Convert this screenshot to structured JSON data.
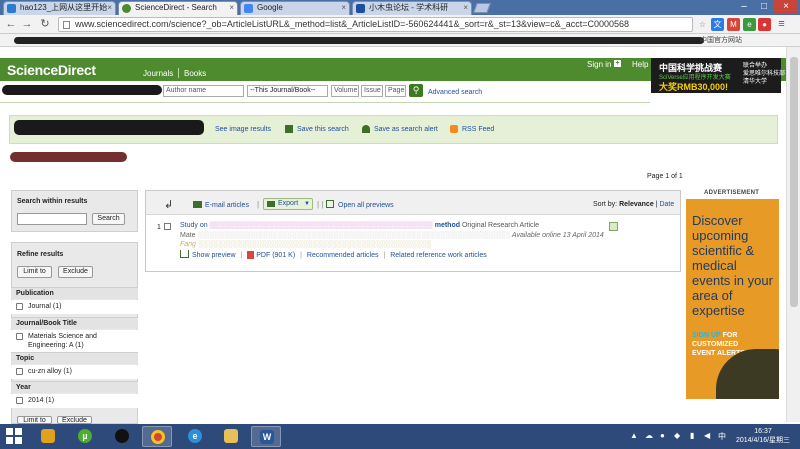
{
  "browser": {
    "tabs": [
      {
        "label": "hao123_上网从这里开始",
        "favicon_color": "#2d7bd1"
      },
      {
        "label": "ScienceDirect - Search",
        "favicon_color": "#4d8b2e"
      },
      {
        "label": "Google",
        "favicon_color": "#4285f4"
      },
      {
        "label": "小木虫论坛 - 学术科研",
        "favicon_color": "#1b4fa0"
      }
    ],
    "url": "www.sciencedirect.com/science?_ob=ArticleListURL&_method=list&_ArticleListID=-560624441&_sort=r&_st=13&view=c&_acct=C0000568",
    "bookmarks_right": "中国官方网站"
  },
  "header": {
    "logo": "ScienceDirect",
    "nav": [
      "Journals",
      "Books"
    ],
    "sign_in": "Sign in",
    "help": "Help"
  },
  "banner": {
    "line1": "中国科学挑战赛",
    "line2": "SciVerse应用程序开发大赛",
    "line3": "大奖RMB30,000!",
    "side": "联合举办\n爱思唯尔科技部\n清华大学"
  },
  "search": {
    "author_placeholder": "Author name",
    "journal_value": "--This Journal/Book--",
    "volume_placeholder": "Volume",
    "issue_placeholder": "Issue",
    "page_placeholder": "Page",
    "advanced": "Advanced search"
  },
  "resultsbar": {
    "image_results": "See image results",
    "save_search": "Save this search",
    "save_alert": "Save as search alert",
    "rss": "RSS Feed"
  },
  "pageinfo": "Page 1 of 1",
  "sidebar": {
    "search_within": "Search within results",
    "search_btn": "Search",
    "refine": "Refine results",
    "limit": "Limit to",
    "exclude": "Exclude",
    "facets": [
      {
        "head": "Publication",
        "items": [
          "Journal (1)"
        ]
      },
      {
        "head": "Journal/Book Title",
        "items": [
          "Materials Science and Engineering: A (1)"
        ]
      },
      {
        "head": "Topic",
        "items": [
          "cu-zn alloy (1)"
        ]
      },
      {
        "head": "Year",
        "items": [
          "2014 (1)"
        ]
      }
    ]
  },
  "results": {
    "email": "E-mail articles",
    "export": "Export",
    "open_previews": "Open all previews",
    "sort_label": "Sort by:",
    "sort_relevance": "Relevance",
    "sort_date": "Date",
    "item": {
      "num": "1",
      "title_start": "Study on",
      "title_end": "method",
      "type": "Original Research Article",
      "meta_start": "Mate",
      "available": "Available online 13 April 2014",
      "author_frag": "Fang",
      "show_preview": "Show preview",
      "pdf": "PDF (901 K)",
      "recommended": "Recommended articles",
      "related": "Related reference work articles"
    }
  },
  "ad": {
    "label": "ADVERTISEMENT",
    "headline": "Discover upcoming scientific & medical events in your area of expertise",
    "cta1": "SIGN UP",
    "cta2": "FOR",
    "cta3": "CUSTOMIZED EVENT ALERTS"
  },
  "taskbar": {
    "time": "16:37",
    "date": "2014/4/16/星期三"
  }
}
